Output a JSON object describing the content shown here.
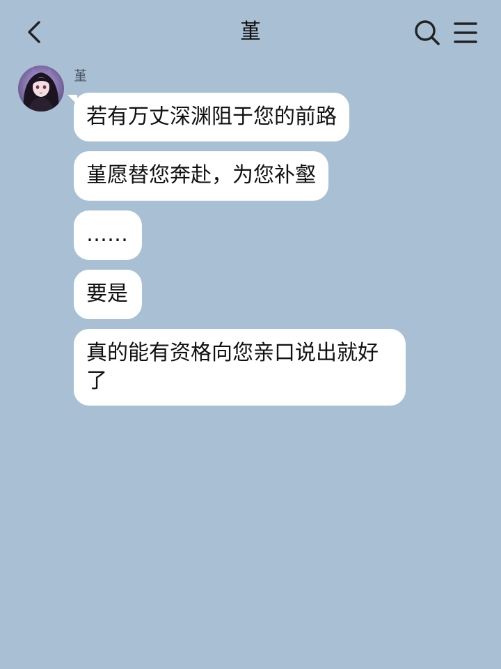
{
  "header": {
    "title": "堇"
  },
  "icons": {
    "back": "chevron-left-icon",
    "search": "search-icon",
    "menu": "menu-icon"
  },
  "colors": {
    "background": "#a9bfd3",
    "bubble": "#ffffff",
    "text": "#111111",
    "sender_name": "#4a5560"
  },
  "chat": {
    "sender": "堇",
    "messages": [
      {
        "text": "若有万丈深渊阻于您的前路"
      },
      {
        "text": "堇愿替您奔赴，为您补壑"
      },
      {
        "text": "……"
      },
      {
        "text": "要是"
      },
      {
        "text": "真的能有资格向您亲口说出就好了"
      }
    ]
  }
}
